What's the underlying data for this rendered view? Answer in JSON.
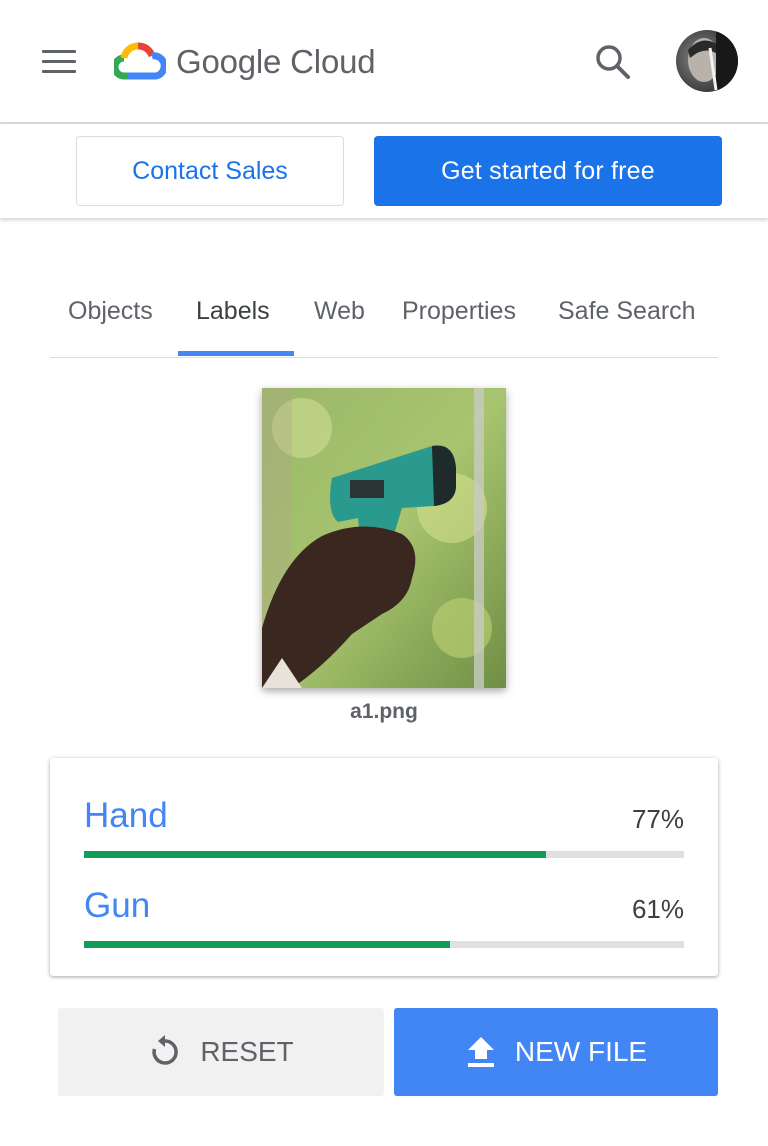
{
  "header": {
    "brand": "Google Cloud",
    "icons": {
      "menu": "hamburger-menu-icon",
      "search": "search-icon",
      "avatar": "user-avatar"
    }
  },
  "cta": {
    "contact_label": "Contact Sales",
    "start_label": "Get started for free"
  },
  "tabs": [
    {
      "label": "Objects",
      "active": false
    },
    {
      "label": "Labels",
      "active": true
    },
    {
      "label": "Web",
      "active": false
    },
    {
      "label": "Properties",
      "active": false
    },
    {
      "label": "Safe Search",
      "active": false
    }
  ],
  "image": {
    "filename": "a1.png"
  },
  "results": [
    {
      "label": "Hand",
      "percent_text": "77%",
      "confidence": 0.77
    },
    {
      "label": "Gun",
      "percent_text": "61%",
      "confidence": 0.61
    }
  ],
  "actions": {
    "reset_label": "RESET",
    "new_file_label": "NEW FILE"
  },
  "colors": {
    "primary_blue": "#1a73e8",
    "label_blue": "#4285f4",
    "bar_green": "#0f9d58",
    "track_gray": "#e0e0e0"
  }
}
